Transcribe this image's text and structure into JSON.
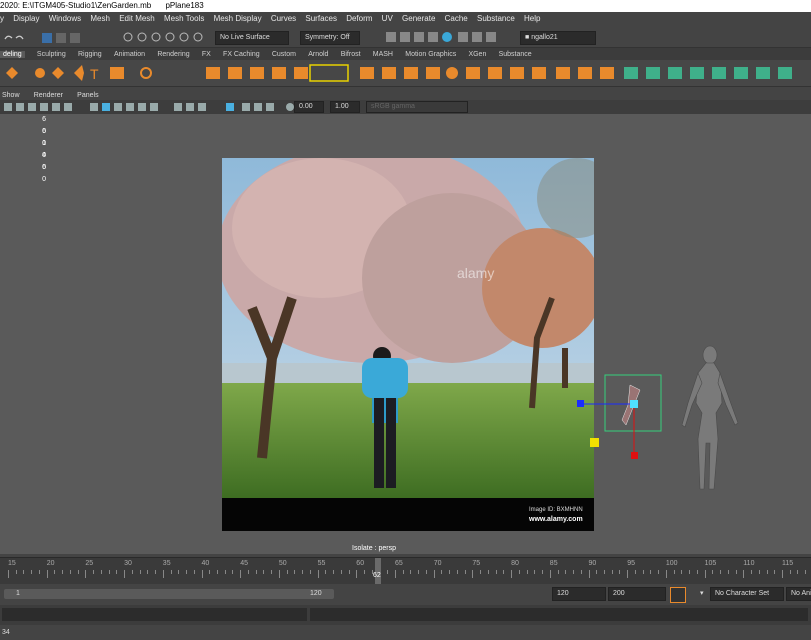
{
  "window": {
    "title": "2020: E:\\ITGM405-Studio1\\ZenGarden.mb",
    "object": "pPlane183"
  },
  "menubar": [
    "y",
    "Display",
    "Windows",
    "Mesh",
    "Edit Mesh",
    "Mesh Tools",
    "Mesh Display",
    "Curves",
    "Surfaces",
    "Deform",
    "UV",
    "Generate",
    "Cache",
    "Substance",
    "Help"
  ],
  "status": {
    "live_surface": "No Live Surface",
    "symmetry": "Symmetry: Off",
    "user": "ngallo21"
  },
  "shelf_tabs": [
    "deling",
    "Sculpting",
    "Rigging",
    "Animation",
    "Rendering",
    "FX",
    "FX Caching",
    "Custom",
    "Arnold",
    "Bifrost",
    "MASH",
    "Motion Graphics",
    "XGen",
    "Substance"
  ],
  "panel_menu": [
    "Show",
    "Renderer",
    "Panels"
  ],
  "panel_toolbar": {
    "exposure": "0.00",
    "gamma": "1.00",
    "color_space": "sRGB gamma"
  },
  "hud_rows": [
    [
      "6",
      "0"
    ],
    [
      "6",
      "0"
    ],
    [
      "1",
      "0"
    ],
    [
      "4",
      "0"
    ],
    [
      "6",
      "0"
    ]
  ],
  "image_plane": {
    "watermark": "alamy",
    "image_id": "Image ID: BXMHNN",
    "url": "www.alamy.com"
  },
  "viewport_label": "Isolate : persp",
  "timeline": {
    "ticks": [
      "15",
      "20",
      "25",
      "30",
      "35",
      "40",
      "45",
      "50",
      "55",
      "60",
      "65",
      "70",
      "75",
      "80",
      "85",
      "90",
      "95",
      "100",
      "105",
      "110",
      "115"
    ],
    "current_frame": "62"
  },
  "range": {
    "start": "1",
    "inner_end": "120",
    "end": "120",
    "anim_end": "200",
    "character_set": "No Character Set",
    "anim_layer": "No Ani"
  },
  "help_line": "34",
  "colors": {
    "accent_orange": "#e98a2c",
    "teal": "#3fb08a",
    "manip_blue": "#1a2cff",
    "manip_red": "#e01010",
    "manip_yellow": "#f2e000",
    "selection_green": "#35d07c"
  }
}
